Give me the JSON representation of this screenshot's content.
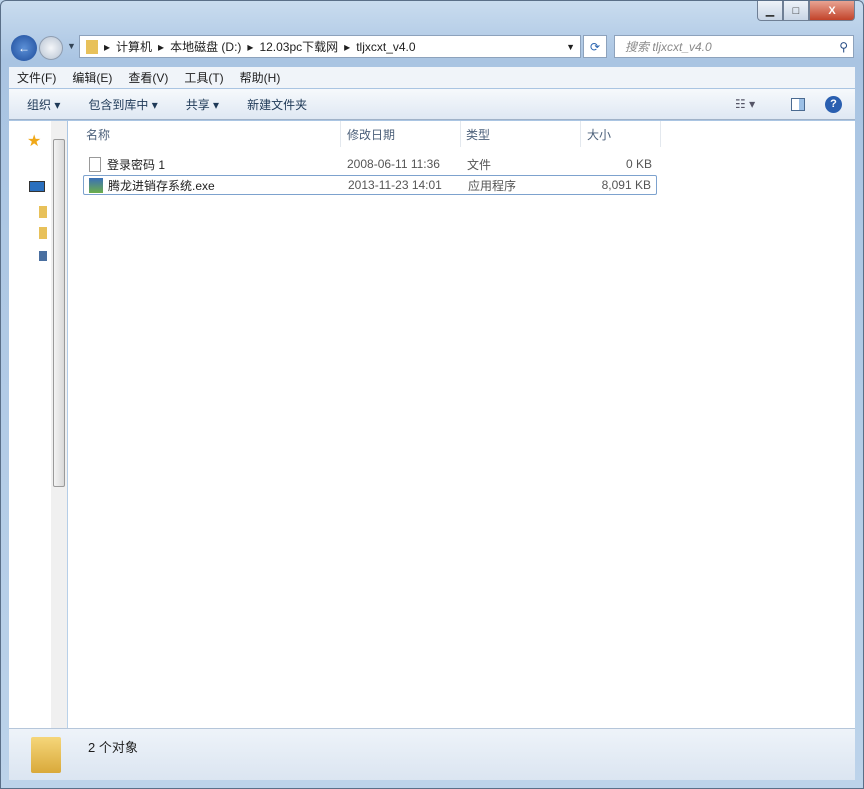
{
  "address": {
    "crumbs": [
      "计算机",
      "本地磁盘 (D:)",
      "12.03pc下载网",
      "tljxcxt_v4.0"
    ]
  },
  "search": {
    "placeholder": "搜索 tljxcxt_v4.0"
  },
  "menu": [
    "文件(F)",
    "编辑(E)",
    "查看(V)",
    "工具(T)",
    "帮助(H)"
  ],
  "toolbar": {
    "organize": "组织 ▾",
    "include": "包含到库中 ▾",
    "share": "共享 ▾",
    "new_folder": "新建文件夹"
  },
  "columns": {
    "name": "名称",
    "date": "修改日期",
    "type": "类型",
    "size": "大小"
  },
  "files": [
    {
      "name": "登录密码 1",
      "date": "2008-06-11 11:36",
      "type": "文件",
      "size": "0 KB",
      "icon": "document-icon"
    },
    {
      "name": "腾龙进销存系统.exe",
      "date": "2013-11-23 14:01",
      "type": "应用程序",
      "size": "8,091 KB",
      "icon": "exe-icon"
    }
  ],
  "status": {
    "count": "2 个对象"
  }
}
